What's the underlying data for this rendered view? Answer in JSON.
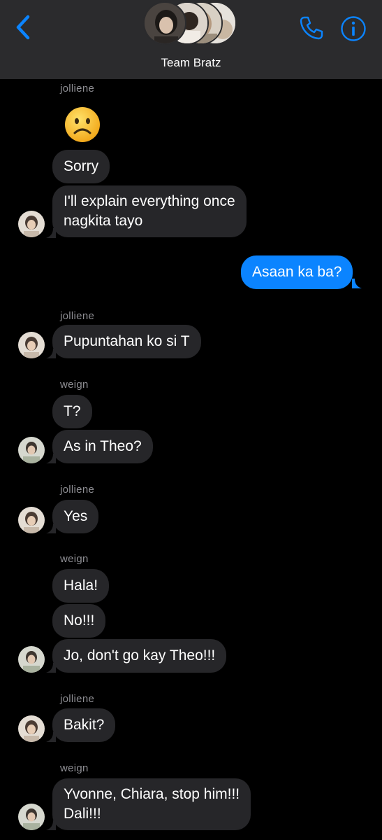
{
  "header": {
    "group_name": "Team Bratz",
    "back_icon": "chevron-left-icon",
    "call_icon": "phone-icon",
    "info_icon": "info-icon",
    "accent": "#0b84ff"
  },
  "messages": [
    {
      "sender": "jolliene",
      "emoji": "frowning-face-emoji",
      "texts": [
        "Sorry",
        "I'll explain everything once",
        "nagkita tayo"
      ]
    },
    {
      "outgoing": "Asaan ka ba?"
    },
    {
      "sender": "jolliene",
      "text": "Pupuntahan ko si T"
    },
    {
      "sender": "weign",
      "texts": [
        "T?",
        "As in Theo?"
      ]
    },
    {
      "sender": "jolliene",
      "text": "Yes"
    },
    {
      "sender": "weign",
      "texts": [
        "Hala!",
        "No!!!",
        "Jo, don't go kay Theo!!!"
      ]
    },
    {
      "sender": "jolliene",
      "text": "Bakit?"
    },
    {
      "sender": "weign",
      "texts": [
        "Yvonne, Chiara, stop him!!!",
        "Dali!!!"
      ]
    }
  ]
}
